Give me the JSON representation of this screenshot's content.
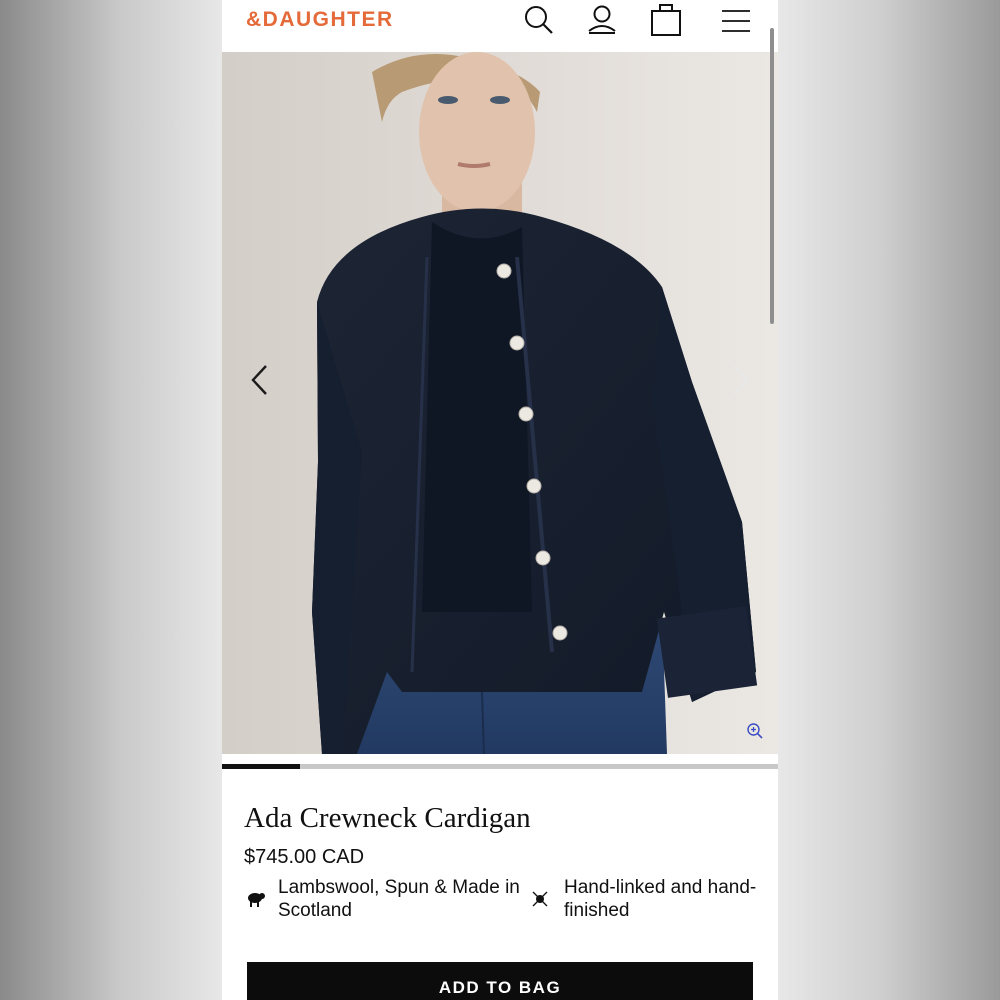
{
  "brand": {
    "logo": "&DAUGHTER",
    "accent_color": "#e56a3a"
  },
  "header": {
    "icons": [
      "search-icon",
      "account-icon",
      "bag-icon",
      "menu-icon"
    ]
  },
  "gallery": {
    "prev_icon": "chevron-left-icon",
    "next_icon": "chevron-right-icon",
    "zoom_icon": "zoom-in-icon",
    "progress": 0.14
  },
  "product": {
    "name": "Ada Crewneck Cardigan",
    "price": "$745.00 CAD",
    "features": [
      {
        "icon": "sheep-icon",
        "text": "Lambswool, Spun & Made in Scotland"
      },
      {
        "icon": "needle-icon",
        "text": "Hand-linked and hand-finished"
      }
    ],
    "add_to_bag": "ADD TO BAG"
  }
}
